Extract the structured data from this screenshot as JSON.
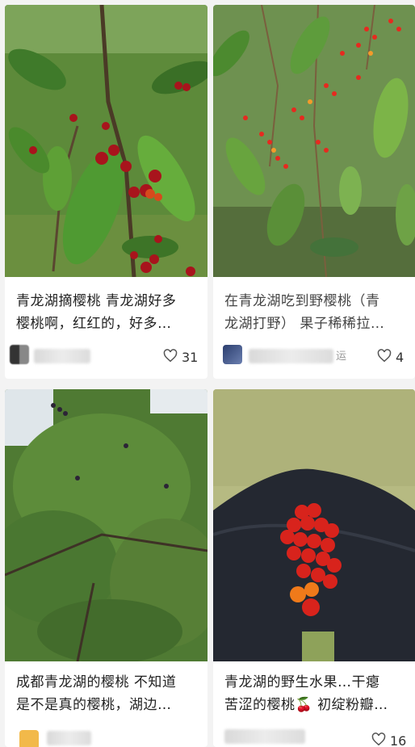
{
  "feed": {
    "posts": [
      {
        "title_line1": "青龙湖摘樱桃 青龙湖好多",
        "title_line2": "樱桃啊，红红的，好多…",
        "likes": "31",
        "image": "cherry-tree-with-red-fruit"
      },
      {
        "title_line1": "在青龙湖吃到野樱桃（青",
        "title_line2": "龙湖打野） 果子稀稀拉…",
        "author_suffix": "运",
        "likes": "4",
        "image": "wild-cherry-branches"
      },
      {
        "title_line1": "成都青龙湖的樱桃 不知道",
        "title_line2": "是不是真的樱桃，湖边…",
        "image": "cherry-tree-canopy"
      },
      {
        "title_line1": "青龙湖的野生水果…干瘪",
        "title_line2": "苦涩的樱桃🍒 初绽粉瓣…",
        "likes": "16",
        "image": "cherries-in-hand"
      }
    ],
    "colors": {
      "background": "#f3f3f3",
      "card": "#ffffff",
      "text": "#222222",
      "cherry_red": "#d8231c"
    },
    "icons": [
      "heart-outline-icon"
    ]
  }
}
